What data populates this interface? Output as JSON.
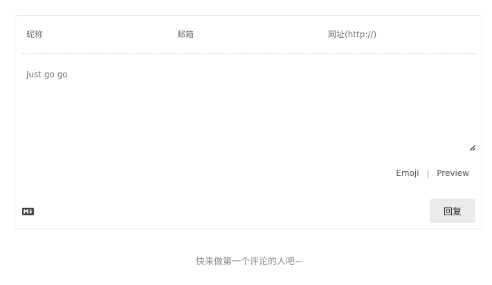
{
  "form": {
    "nick_placeholder": "昵称",
    "mail_placeholder": "邮箱",
    "link_placeholder": "网址(http://)",
    "nick_value": "",
    "mail_value": "",
    "link_value": "",
    "comment_placeholder": "Just go go",
    "comment_value": ""
  },
  "toolbar": {
    "emoji_label": "Emoji",
    "separator": "|",
    "preview_label": "Preview"
  },
  "footer": {
    "markdown_icon": "markdown-icon",
    "submit_label": "回复"
  },
  "comments": {
    "empty_text": "快来做第一个评论的人吧~"
  }
}
